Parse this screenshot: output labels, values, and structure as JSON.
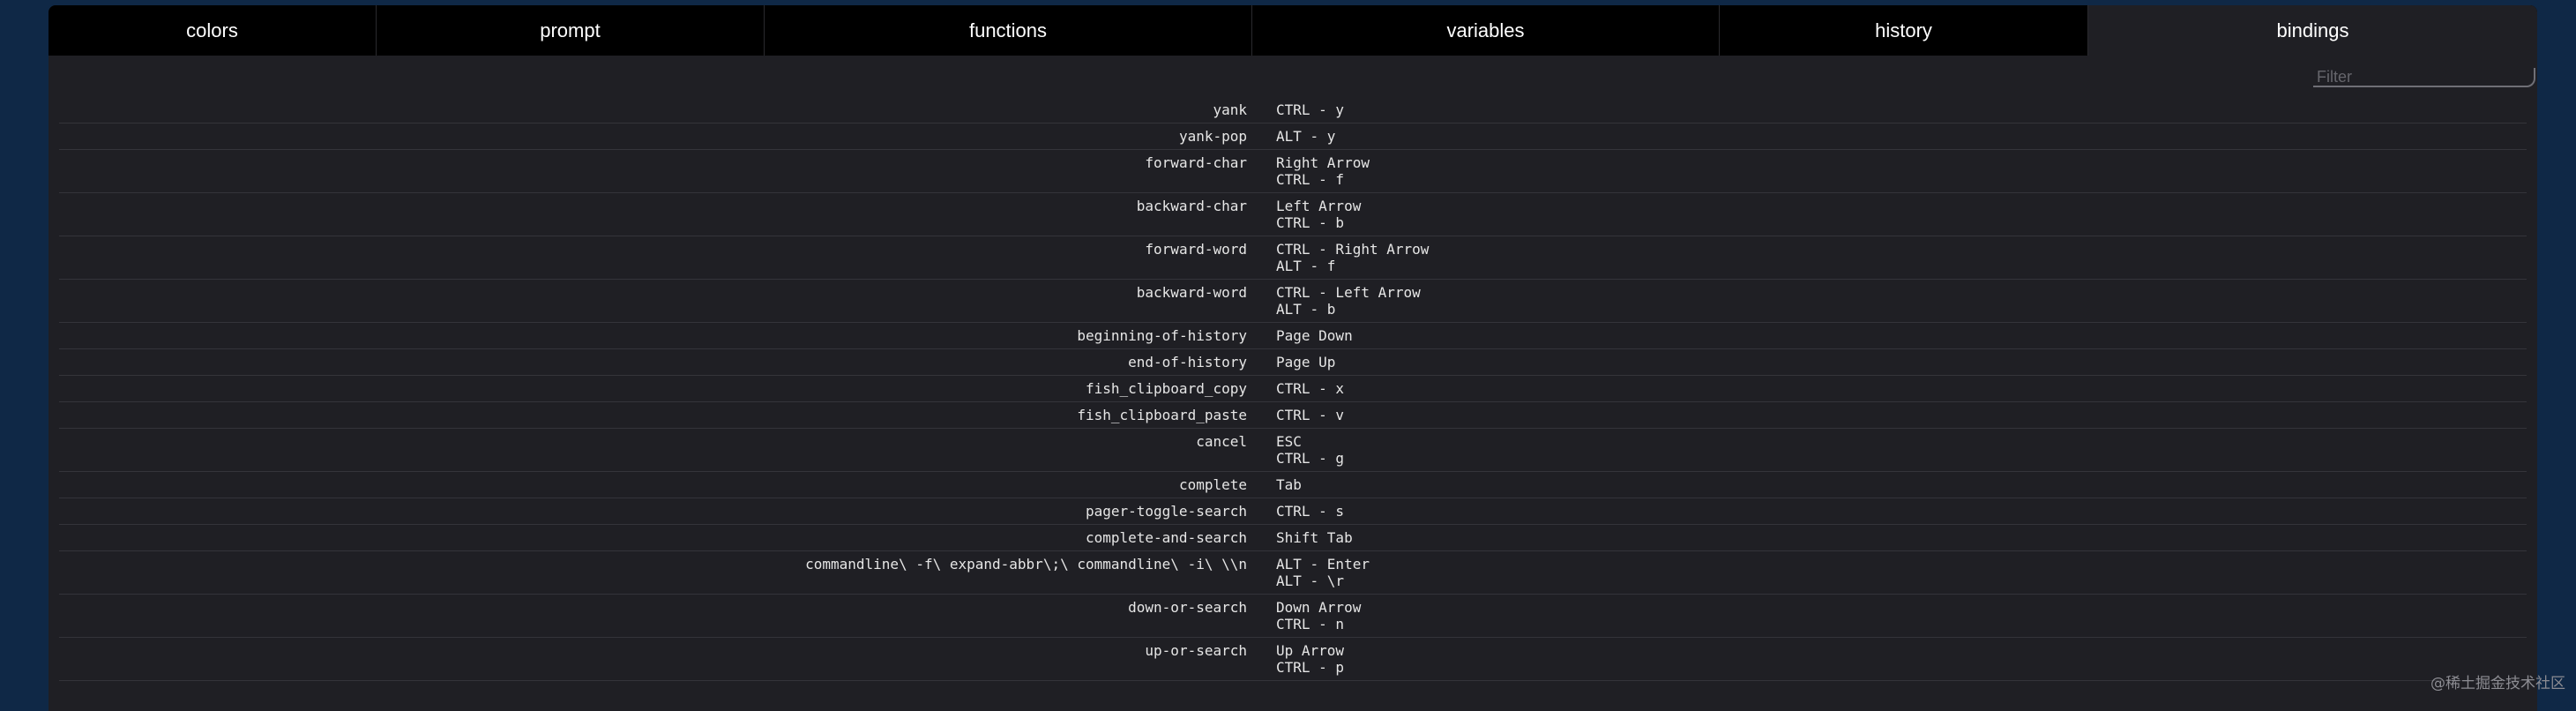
{
  "tabs": [
    {
      "label": "colors",
      "active": false
    },
    {
      "label": "prompt",
      "active": false
    },
    {
      "label": "functions",
      "active": false
    },
    {
      "label": "variables",
      "active": false
    },
    {
      "label": "history",
      "active": false
    },
    {
      "label": "bindings",
      "active": true
    }
  ],
  "filter": {
    "placeholder": "Filter",
    "value": ""
  },
  "bindings": [
    {
      "command": "yank",
      "keys": [
        "CTRL - y"
      ]
    },
    {
      "command": "yank-pop",
      "keys": [
        "ALT - y"
      ]
    },
    {
      "command": "forward-char",
      "keys": [
        "Right Arrow",
        "CTRL - f"
      ]
    },
    {
      "command": "backward-char",
      "keys": [
        "Left Arrow",
        "CTRL - b"
      ]
    },
    {
      "command": "forward-word",
      "keys": [
        "CTRL - Right Arrow",
        "ALT - f"
      ]
    },
    {
      "command": "backward-word",
      "keys": [
        "CTRL - Left Arrow",
        "ALT - b"
      ]
    },
    {
      "command": "beginning-of-history",
      "keys": [
        "Page Down"
      ]
    },
    {
      "command": "end-of-history",
      "keys": [
        "Page Up"
      ]
    },
    {
      "command": "fish_clipboard_copy",
      "keys": [
        "CTRL - x"
      ]
    },
    {
      "command": "fish_clipboard_paste",
      "keys": [
        "CTRL - v"
      ]
    },
    {
      "command": "cancel",
      "keys": [
        "ESC",
        "CTRL - g"
      ]
    },
    {
      "command": "complete",
      "keys": [
        "Tab"
      ]
    },
    {
      "command": "pager-toggle-search",
      "keys": [
        "CTRL - s"
      ]
    },
    {
      "command": "complete-and-search",
      "keys": [
        "Shift Tab"
      ]
    },
    {
      "command": "commandline\\ -f\\ expand-abbr\\;\\ commandline\\ -i\\ \\\\n",
      "keys": [
        "ALT - Enter",
        "ALT - \\r"
      ]
    },
    {
      "command": "down-or-search",
      "keys": [
        "Down Arrow",
        "CTRL - n"
      ]
    },
    {
      "command": "up-or-search",
      "keys": [
        "Up Arrow",
        "CTRL - p"
      ]
    }
  ],
  "watermark": "@稀土掘金技术社区"
}
